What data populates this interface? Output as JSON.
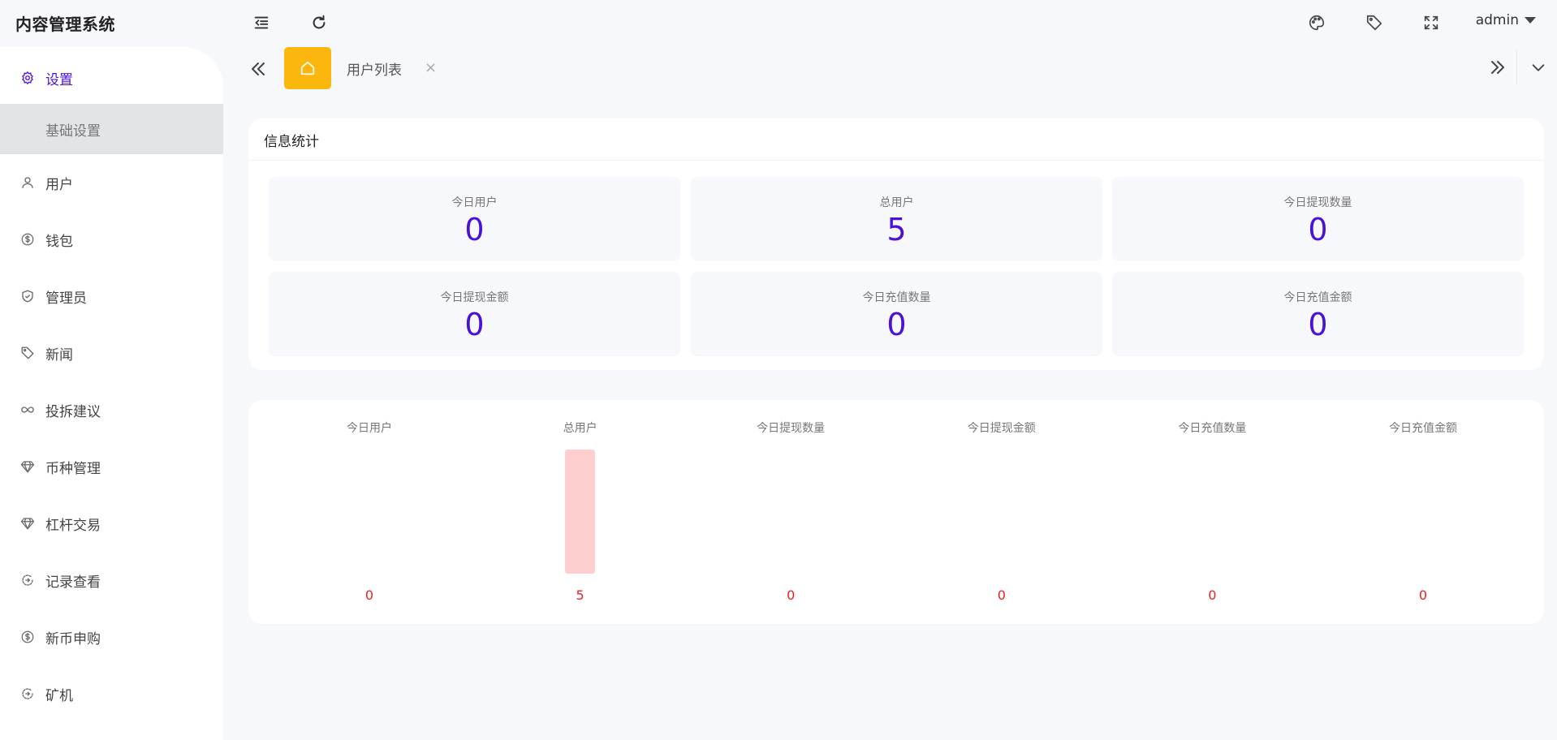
{
  "app": {
    "title": "内容管理系统"
  },
  "header": {
    "user_name": "admin"
  },
  "sidebar": {
    "items": [
      {
        "label": "设置",
        "icon": "gear-icon",
        "active": true
      },
      {
        "label": "用户",
        "icon": "user-icon"
      },
      {
        "label": "钱包",
        "icon": "coin-icon"
      },
      {
        "label": "管理员",
        "icon": "shield-icon"
      },
      {
        "label": "新闻",
        "icon": "tag-icon"
      },
      {
        "label": "投拆建议",
        "icon": "infinity-icon"
      },
      {
        "label": "币种管理",
        "icon": "diamond-icon"
      },
      {
        "label": "杠杆交易",
        "icon": "diamond-icon"
      },
      {
        "label": "记录查看",
        "icon": "clock-arrow-icon"
      },
      {
        "label": "新币申购",
        "icon": "coin-icon"
      },
      {
        "label": "矿机",
        "icon": "clock-arrow-icon"
      }
    ],
    "submenu": {
      "label": "基础设置"
    }
  },
  "tabs": {
    "home_icon": "home-icon",
    "current": "用户列表",
    "close": "×"
  },
  "stats": {
    "title": "信息统计",
    "items": [
      {
        "label": "今日用户",
        "value": "0"
      },
      {
        "label": "总用户",
        "value": "5"
      },
      {
        "label": "今日提现数量",
        "value": "0"
      },
      {
        "label": "今日提现金额",
        "value": "0"
      },
      {
        "label": "今日充值数量",
        "value": "0"
      },
      {
        "label": "今日充值金额",
        "value": "0"
      }
    ]
  },
  "colors": {
    "accent": "#4a12d6",
    "home_tab": "#fbb70e",
    "bar_fill": "#ffcfcf",
    "bar_value": "#e52323"
  },
  "chart_data": {
    "type": "bar",
    "categories": [
      "今日用户",
      "总用户",
      "今日提现数量",
      "今日提现金额",
      "今日充值数量",
      "今日充值金额"
    ],
    "values": [
      0,
      5,
      0,
      0,
      0,
      0
    ],
    "title": "",
    "xlabel": "",
    "ylabel": "",
    "ylim": [
      0,
      5
    ],
    "grid": false,
    "data_labels_position": "bottom"
  }
}
